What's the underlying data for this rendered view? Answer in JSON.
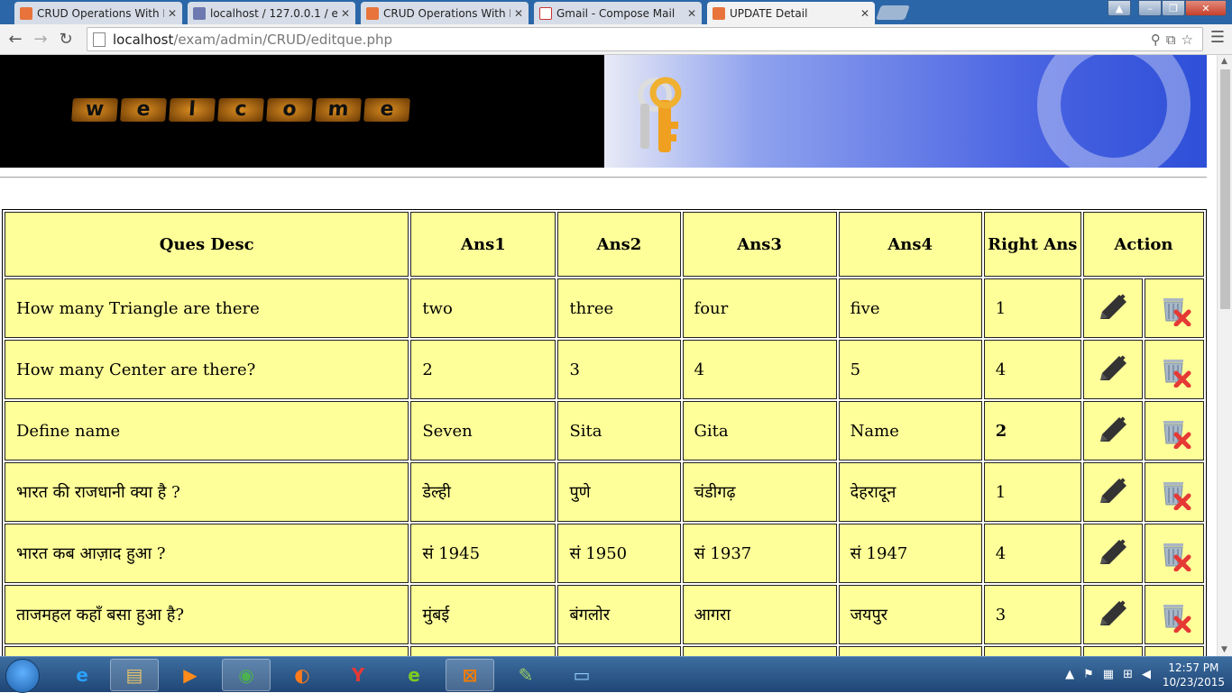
{
  "browser": {
    "tabs": [
      {
        "title": "CRUD Operations With PH",
        "favicon": "xampp-icon"
      },
      {
        "title": "localhost / 127.0.0.1 / exa",
        "favicon": "phpmyadmin-icon"
      },
      {
        "title": "CRUD Operations With PH",
        "favicon": "xampp-icon"
      },
      {
        "title": "Gmail - Compose Mail",
        "favicon": "gmail-icon"
      },
      {
        "title": "UPDATE Detail",
        "favicon": "xampp-icon",
        "active": true
      }
    ],
    "url_host": "localhost",
    "url_path": "/exam/admin/CRUD/editque.php"
  },
  "page": {
    "banner_text": [
      "w",
      "e",
      "l",
      "c",
      "o",
      "m",
      "e"
    ],
    "table": {
      "headers": [
        "Ques Desc",
        "Ans1",
        "Ans2",
        "Ans3",
        "Ans4",
        "Right Ans",
        "Action"
      ],
      "rows": [
        {
          "q": "How many Triangle are there",
          "a1": "two",
          "a2": "three",
          "a3": "four",
          "a4": "five",
          "right": "1",
          "right_bold": false
        },
        {
          "q": "How many Center are there?",
          "a1": "2",
          "a2": "3",
          "a3": "4",
          "a4": "5",
          "right": "4",
          "right_bold": false
        },
        {
          "q": "Define name",
          "a1": "Seven",
          "a2": "Sita",
          "a3": "Gita",
          "a4": "Name",
          "right": "2",
          "right_bold": true
        },
        {
          "q": "भारत की राजधानी क्या है ?",
          "a1": "डेल्ही",
          "a2": "पुणे",
          "a3": "चंडीगढ़",
          "a4": "देहरादून",
          "right": "1",
          "right_bold": false
        },
        {
          "q": "भारत कब आज़ाद हुआ ?",
          "a1": "सं 1945",
          "a2": "सं 1950",
          "a3": "सं 1937",
          "a4": "सं 1947",
          "right": "4",
          "right_bold": false
        },
        {
          "q": "ताजमहल कहाँ बसा हुआ है?",
          "a1": "मुंबई",
          "a2": "बंगलोर",
          "a3": "आगरा",
          "a4": "जयपुर",
          "right": "3",
          "right_bold": false
        }
      ]
    }
  },
  "taskbar": {
    "items": [
      "internet-explorer-icon",
      "file-explorer-icon",
      "media-player-icon",
      "chrome-icon",
      "firefox-icon",
      "yandex-icon",
      "edge-like-icon",
      "xampp-icon",
      "notepad-icon",
      "photos-icon"
    ],
    "time": "12:57 PM",
    "date": "10/23/2015"
  }
}
